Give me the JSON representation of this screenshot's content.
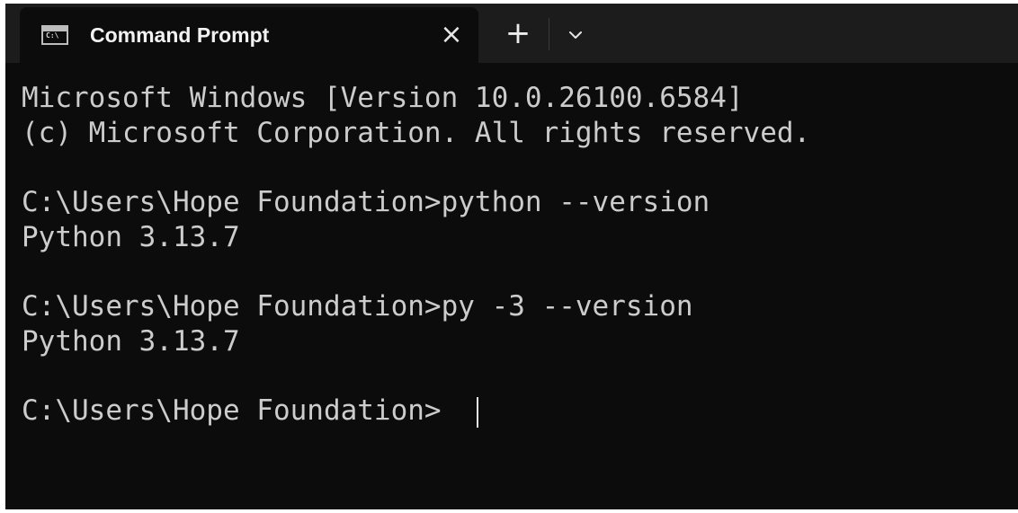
{
  "window": {
    "tab_title": "Command Prompt",
    "icons": {
      "tab": "cmd-icon",
      "close": "close-icon",
      "new_tab": "plus-icon",
      "dropdown": "chevron-down-icon"
    },
    "glyphs": {
      "close": "×",
      "new_tab": "+",
      "tab_icon_prompt": "C:\\"
    }
  },
  "terminal": {
    "lines": [
      "Microsoft Windows [Version 10.0.26100.6584]",
      "(c) Microsoft Corporation. All rights reserved.",
      "",
      "C:\\Users\\Hope Foundation>python --version",
      "Python 3.13.7",
      "",
      "C:\\Users\\Hope Foundation>py -3 --version",
      "Python 3.13.7",
      "",
      "C:\\Users\\Hope Foundation>"
    ]
  },
  "colors": {
    "background": "#0c0c0c",
    "titlebar": "#1c1c1c",
    "text": "#cccccc",
    "tab_text": "#f2f2f2"
  }
}
